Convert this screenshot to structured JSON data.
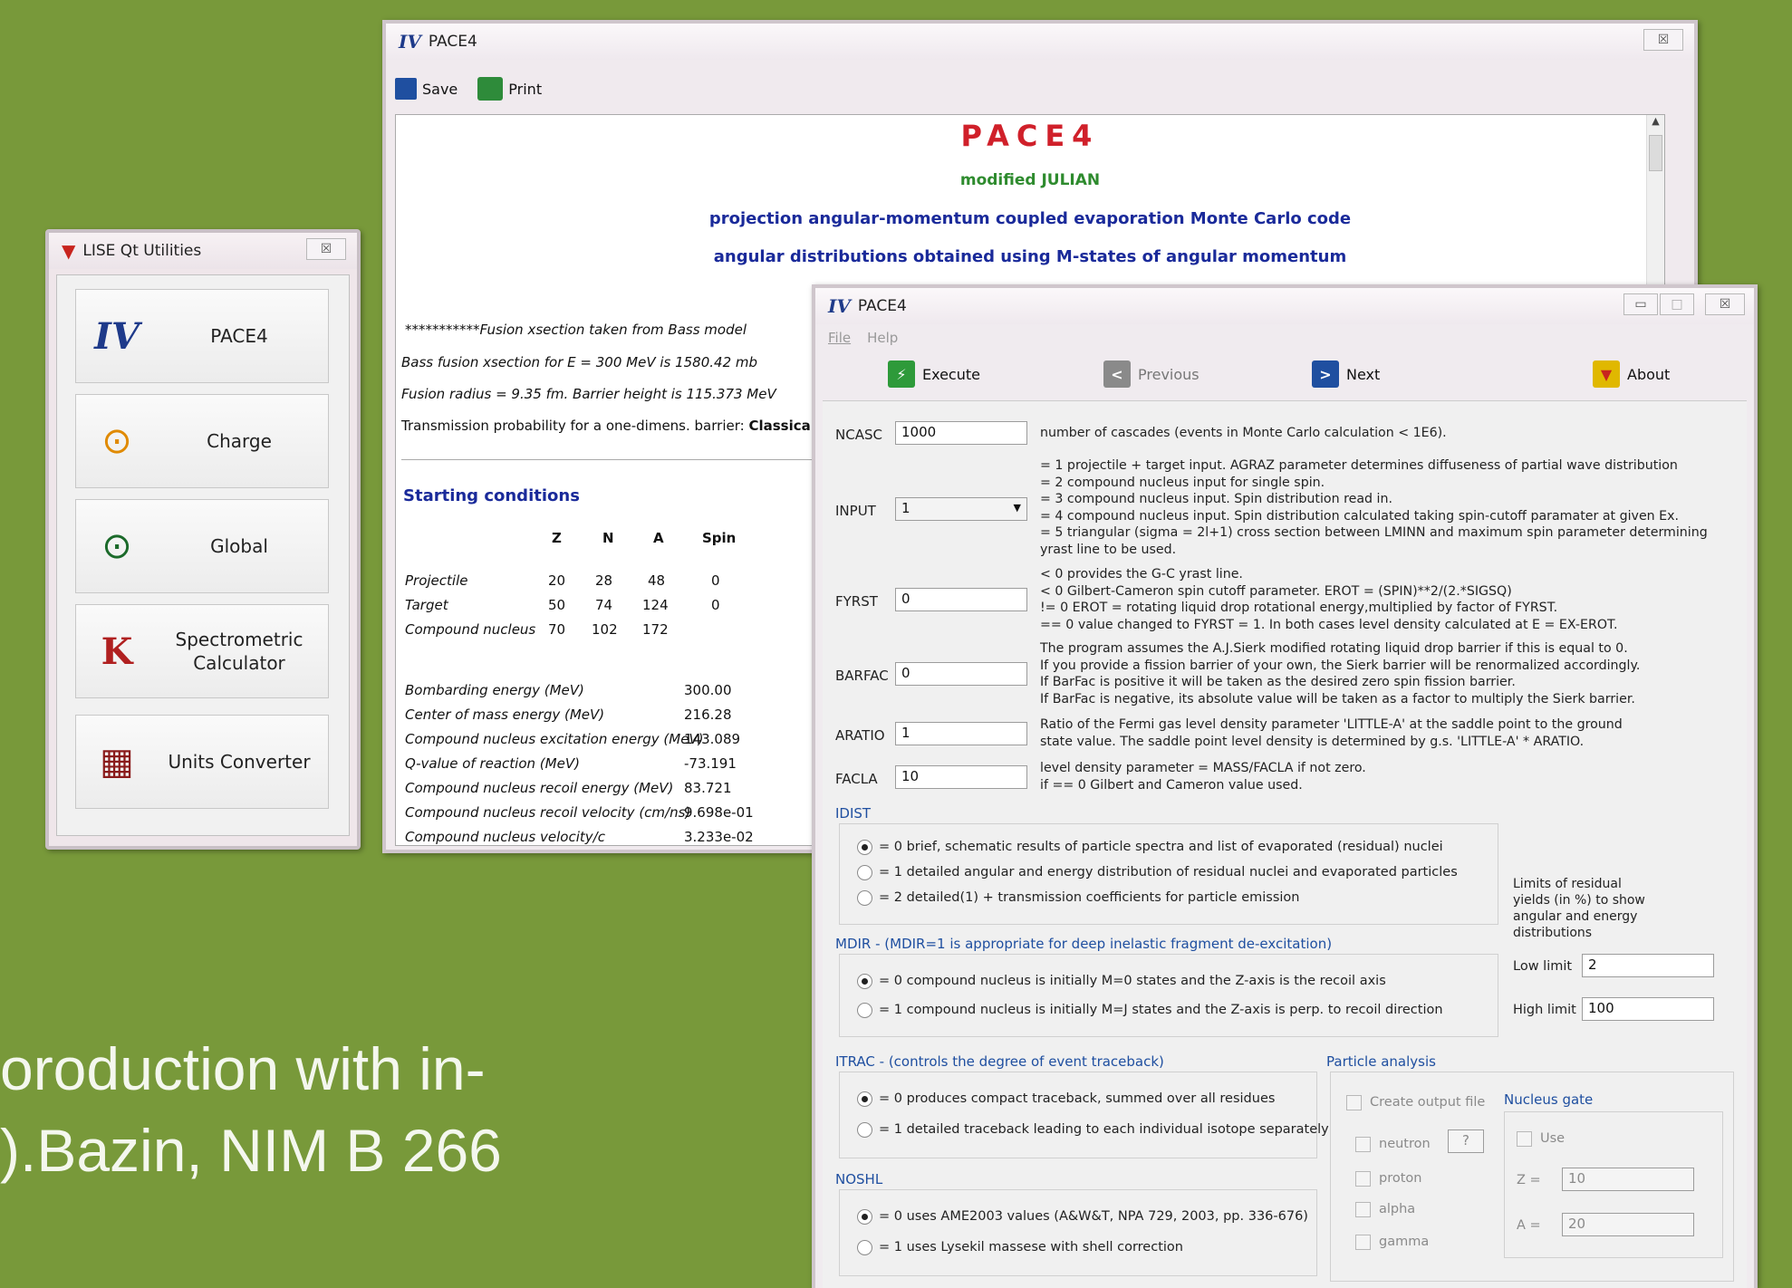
{
  "bg_text": {
    "line1": "oroduction with in-",
    "line2": ").Bazin, NIM B 266"
  },
  "utilities": {
    "title": "LISE Qt Utilities",
    "close": "☒",
    "buttons": [
      {
        "label": "PACE4",
        "icon": "pace4-logo-icon"
      },
      {
        "label": "Charge",
        "icon": "charge-icon"
      },
      {
        "label": "Global",
        "icon": "global-icon"
      },
      {
        "label_line1": "Spectrometric",
        "label_line2": "Calculator",
        "icon": "spectrometric-K-icon"
      },
      {
        "label": "Units Converter",
        "icon": "calculator-icon"
      }
    ]
  },
  "results": {
    "title": "PACE4",
    "toolbar": {
      "save": "Save",
      "print": "Print"
    },
    "heading": "PACE4",
    "sub1": "modified JULIAN",
    "sub2": "projection angular-momentum coupled evaporation Monte Carlo code",
    "sub3": "angular distributions obtained using M-states of angular momentum",
    "fusion": [
      "***********Fusion xsection taken from Bass model",
      "Bass fusion xsection for E = 300 MeV is 1580.42 mb",
      "Fusion radius = 9.35 fm. Barrier height is 115.373 MeV"
    ],
    "transmission": "Transmission probability for a one-dimens. barrier:",
    "transmission_bold": "Classical",
    "starting": "Starting conditions",
    "cols": [
      "Z",
      "N",
      "A",
      "Spin"
    ],
    "rows": [
      {
        "name": "Projectile",
        "z": "20",
        "n": "28",
        "a": "48",
        "spin": "0"
      },
      {
        "name": "Target",
        "z": "50",
        "n": "74",
        "a": "124",
        "spin": "0"
      },
      {
        "name": "Compound nucleus",
        "z": "70",
        "n": "102",
        "a": "172",
        "spin": ""
      }
    ],
    "energies": [
      {
        "name": "Bombarding energy (MeV)",
        "value": "300.00"
      },
      {
        "name": "Center of mass energy (MeV)",
        "value": "216.28"
      },
      {
        "name": "Compound nucleus excitation energy (MeV)",
        "value": "143.089"
      },
      {
        "name": "Q-value of reaction (MeV)",
        "value": "-73.191"
      },
      {
        "name": "Compound nucleus recoil energy (MeV)",
        "value": "83.721"
      },
      {
        "name": "Compound nucleus recoil velocity (cm/ns)",
        "value": "9.698e-01"
      },
      {
        "name": "Compound nucleus velocity/c",
        "value": "3.233e-02"
      }
    ]
  },
  "dialog": {
    "title": "PACE4",
    "menu": {
      "file": "File",
      "help": "Help"
    },
    "toolbar": {
      "execute": "Execute",
      "previous": "Previous",
      "next": "Next",
      "about": "About"
    },
    "ncasc": {
      "label": "NCASC",
      "value": "1000",
      "desc": "number of cascades (events in Monte Carlo calculation < 1E6)."
    },
    "input": {
      "label": "INPUT",
      "value": "1",
      "desc": "= 1 projectile + target input. AGRAZ parameter determines diffuseness of partial wave distribution\n= 2 compound nucleus input for single spin.\n= 3 compound nucleus input. Spin distribution read in.\n= 4 compound nucleus input. Spin distribution calculated taking spin-cutoff paramater at given Ex.\n= 5 triangular (sigma = 2l+1) cross section between LMINN and maximum spin parameter determining\nyrast line to be used."
    },
    "fyrst": {
      "label": "FYRST",
      "value": "0",
      "desc": "< 0 provides the G-C yrast line.\n< 0 Gilbert-Cameron spin cutoff parameter. EROT = (SPIN)**2/(2.*SIGSQ)\n!= 0 EROT = rotating liquid drop rotational energy,multiplied by factor of FYRST.\n== 0 value changed to FYRST = 1. In both cases level density calculated at E = EX-EROT."
    },
    "barfac": {
      "label": "BARFAC",
      "value": "0",
      "desc": "The program assumes the A.J.Sierk modified rotating liquid drop barrier if this is equal to 0.\nIf you provide a fission barrier of your own, the Sierk barrier will be renormalized accordingly.\nIf BarFac is positive it will be taken as the desired zero spin fission barrier.\nIf BarFac is negative, its absolute value will be taken as a factor to multiply the Sierk barrier."
    },
    "aratio": {
      "label": "ARATIO",
      "value": "1",
      "desc": "Ratio of the Fermi gas level density parameter 'LITTLE-A' at the saddle point to the ground\nstate value. The saddle point level density is determined by g.s. 'LITTLE-A' * ARATIO."
    },
    "facla": {
      "label": "FACLA",
      "value": "10",
      "desc": "level density parameter = MASS/FACLA if not zero.\nif == 0 Gilbert and Cameron value used."
    },
    "idist": {
      "title": "IDIST",
      "options": [
        "= 0 brief, schematic results of particle spectra and list of evaporated (residual) nuclei",
        "= 1 detailed angular and energy distribution of residual nuclei and evaporated particles",
        "= 2 detailed(1) + transmission coefficients for particle emission"
      ]
    },
    "limits": {
      "note": "Limits of residual\nyields (in %) to show\nangular and energy\ndistributions",
      "low_label": "Low limit",
      "low": "2",
      "high_label": "High limit",
      "high": "100"
    },
    "mdir": {
      "title": "MDIR -  (MDIR=1 is appropriate for deep inelastic fragment de-excitation)",
      "options": [
        "= 0 compound nucleus is initially M=0 states and the Z-axis is the recoil axis",
        "= 1 compound nucleus is initially M=J states and the Z-axis is perp. to recoil direction"
      ]
    },
    "itrac": {
      "title": "ITRAC -  (controls the degree of event traceback)",
      "options": [
        "= 0 produces compact traceback, summed over all residues",
        "= 1 detailed traceback leading to each individual isotope separately"
      ]
    },
    "noshl": {
      "title": "NOSHL",
      "options": [
        "= 0 uses AME2003 values (A&W&T, NPA 729, 2003, pp. 336-676)",
        "= 1 uses Lysekil massese with shell correction"
      ]
    },
    "particle": {
      "title": "Particle analysis",
      "create": "Create output file",
      "neutron": "neutron",
      "q": "?",
      "proton": "proton",
      "alpha": "alpha",
      "gamma": "gamma"
    },
    "gate": {
      "title": "Nucleus gate",
      "use": "Use",
      "z_label": "Z =",
      "z": "10",
      "a_label": "A =",
      "a": "20"
    }
  },
  "colors": {
    "background": "#78993a",
    "pace_red": "#d0202a",
    "green_text": "#2e8b2e",
    "navy_text": "#1a2a9a"
  }
}
